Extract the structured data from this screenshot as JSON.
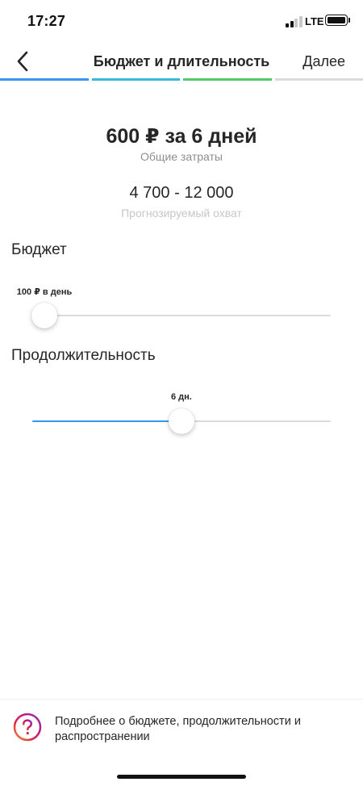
{
  "status_bar": {
    "time": "17:27",
    "network": "LTE",
    "signal_bars": 4,
    "signal_bars_active": 2,
    "battery_level": 1.0
  },
  "nav": {
    "back_icon": "chevron-left-icon",
    "title": "Бюджет и длительность",
    "next_label": "Далее"
  },
  "progress_steps": [
    {
      "state": "done",
      "color": "#3897f0"
    },
    {
      "state": "done",
      "color": "#3bb8d8"
    },
    {
      "state": "current",
      "color": "#4fc96b"
    },
    {
      "state": "todo",
      "color": "#dbdbdb"
    }
  ],
  "summary": {
    "total": "600 ₽ за 6 дней",
    "total_caption": "Общие затраты",
    "reach": "4 700 - 12 000",
    "reach_caption": "Прогнозируемый охват"
  },
  "budget": {
    "title": "Бюджет",
    "value_label": "100 ₽ в день",
    "fraction": 0.04
  },
  "duration": {
    "title": "Продолжительность",
    "value_label": "6 дн.",
    "fraction": 0.5
  },
  "footer": {
    "help_icon": "question-circle-icon",
    "help_text": "Подробнее о бюджете, продолжительности и распространении"
  },
  "colors": {
    "accent": "#3897f0",
    "help_gradient": [
      "#f09433",
      "#dc2743",
      "#bc1888",
      "#8a3ab9"
    ]
  }
}
